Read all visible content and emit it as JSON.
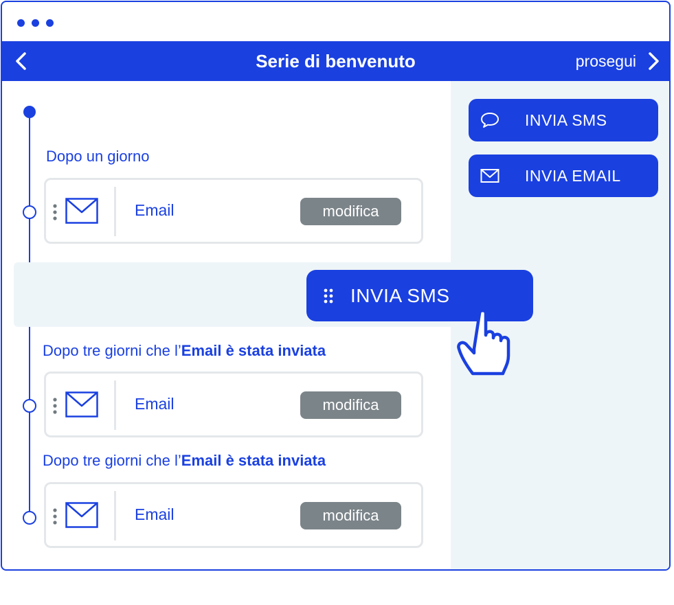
{
  "header": {
    "title": "Serie di benvenuto",
    "continue_label": "prosegui",
    "back_icon": "chevron-left-icon",
    "forward_icon": "chevron-right-icon"
  },
  "colors": {
    "accent": "#1a40e0",
    "panel": "#eef5f8",
    "edit_button": "#7b8489",
    "card_border": "#e4e7ea"
  },
  "sidebar": {
    "actions": [
      {
        "label": "INVIA SMS",
        "icon": "speech-bubble-icon"
      },
      {
        "label": "INVIA EMAIL",
        "icon": "envelope-icon"
      }
    ]
  },
  "steps": [
    {
      "label_plain": "Dopo un giorno",
      "label_bold": "",
      "card": {
        "title": "Email",
        "edit_label": "modifica",
        "icon": "envelope-icon"
      }
    },
    {
      "label_plain": "Dopo tre giorni che l’",
      "label_bold": "Email è stata inviata",
      "card": {
        "title": "Email",
        "edit_label": "modifica",
        "icon": "envelope-icon"
      }
    },
    {
      "label_plain": "Dopo tre giorni che l’",
      "label_bold": "Email è stata inviata",
      "card": {
        "title": "Email",
        "edit_label": "modifica",
        "icon": "envelope-icon"
      }
    }
  ],
  "dragging": {
    "label": "INVIA SMS",
    "icon": "drag-handle-icon",
    "cursor_icon": "hand-pointer-icon"
  }
}
